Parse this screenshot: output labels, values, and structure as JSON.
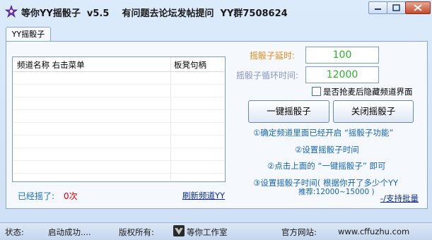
{
  "window": {
    "title": "等你YY摇骰子  v5.5    有问题去论坛发帖提问  YY群7508624"
  },
  "tab": {
    "label": "YY摇骰子"
  },
  "list": {
    "col1": "频道名称 右击菜单",
    "col2": "板凳句柄"
  },
  "count": {
    "label": "已经摇了:",
    "value": "0次"
  },
  "refresh_link": "刷新频道YY",
  "settings": {
    "delay_label": "摇骰子延时:",
    "delay_value": "100",
    "loop_label": "摇骰子循环时间:",
    "loop_value": "12000",
    "hide_checkbox_label": "是否抢麦后隐藏频道界面"
  },
  "buttons": {
    "start": "一键摇骰子",
    "stop": "关闭摇骰子"
  },
  "instructions": {
    "step1": "①确定频道里面已经开启 “摇骰子功能”",
    "step2": "②设置摇骰子时间",
    "step3": "②点击上面的 “一键摇骰子” 即可",
    "step4": "③设置摇骰子时间( 根据你开了多少个YY",
    "step4_note": "推荐:12000~15000 )"
  },
  "support_link": "-/支持批量",
  "status": {
    "state_label": "状态:",
    "state_value": "启动成功....",
    "copyright_label": "版权所有:",
    "copyright_value": "等你工作室",
    "site_label": "官方网站:",
    "site_value": "www.cffuzhu.com"
  },
  "colors": {
    "accent": "#1565b8",
    "value_green": "#2fae2f",
    "warning_orange": "#ee8a1a",
    "count_red": "#e00000"
  }
}
